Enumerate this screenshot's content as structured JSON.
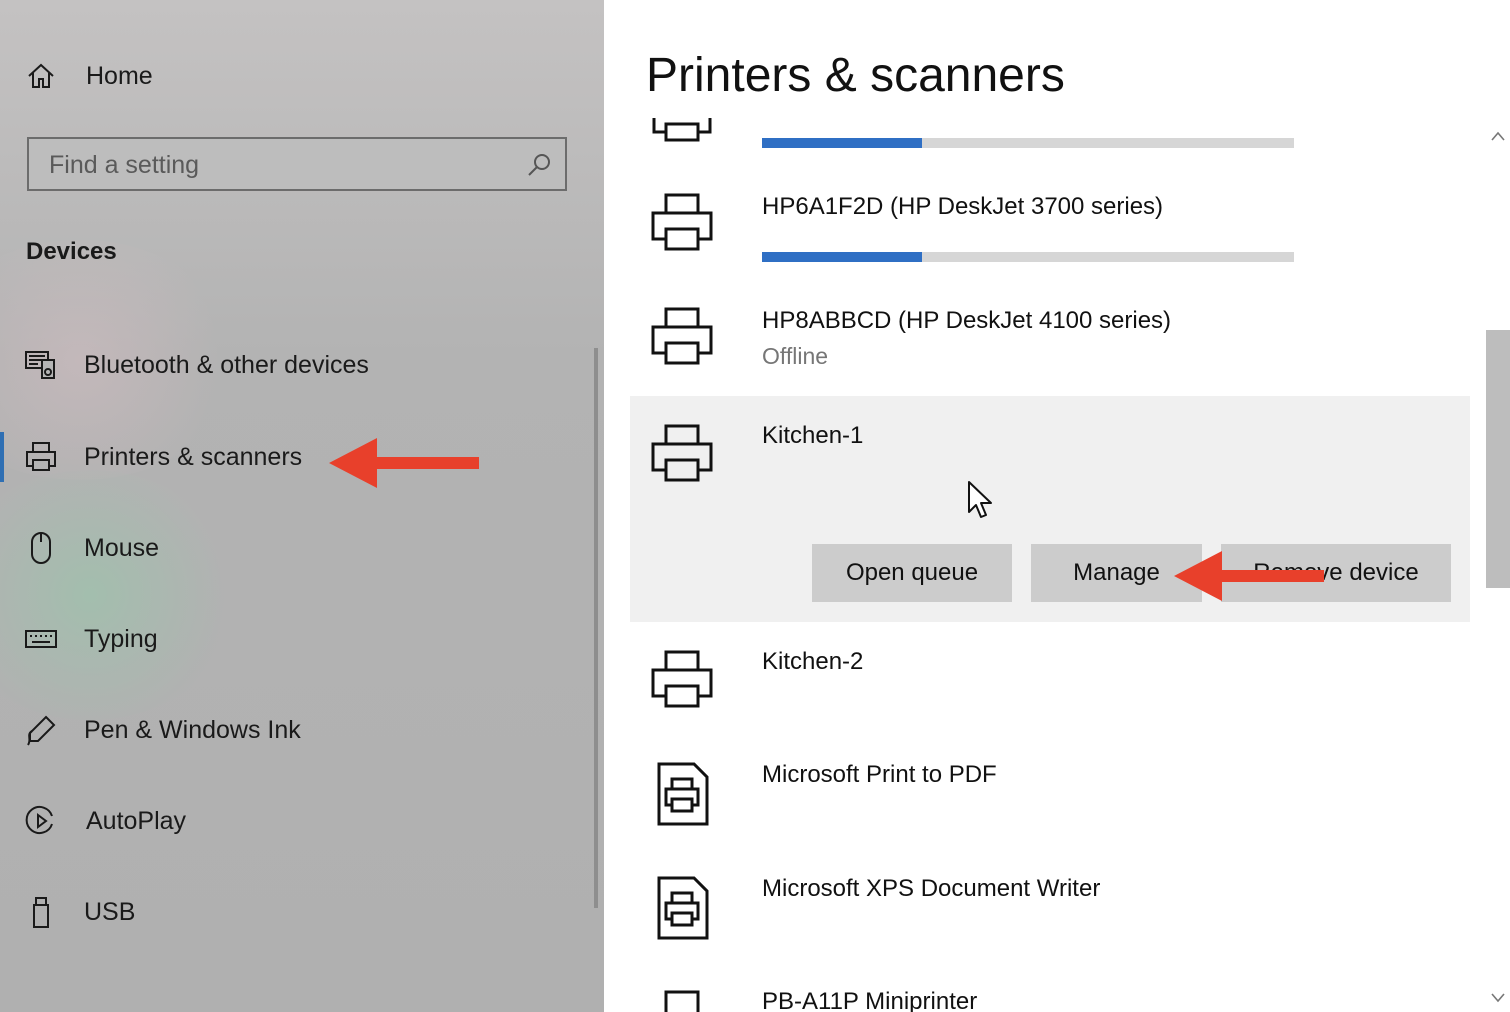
{
  "sidebar": {
    "home_label": "Home",
    "search_placeholder": "Find a setting",
    "section_title": "Devices",
    "items": [
      {
        "label": "Bluetooth & other devices",
        "icon": "bluetooth-devices-icon"
      },
      {
        "label": "Printers & scanners",
        "icon": "printer-icon",
        "selected": true
      },
      {
        "label": "Mouse",
        "icon": "mouse-icon"
      },
      {
        "label": "Typing",
        "icon": "keyboard-icon"
      },
      {
        "label": "Pen & Windows Ink",
        "icon": "pen-icon"
      },
      {
        "label": "AutoPlay",
        "icon": "autoplay-icon"
      },
      {
        "label": "USB",
        "icon": "usb-icon"
      }
    ]
  },
  "main": {
    "title": "Printers & scanners",
    "printers": [
      {
        "name": "",
        "progress": 0.3
      },
      {
        "name": "HP6A1F2D (HP DeskJet 3700 series)",
        "progress": 0.3
      },
      {
        "name": "HP8ABBCD (HP DeskJet 4100 series)",
        "status": "Offline"
      },
      {
        "name": "Kitchen-1",
        "selected": true
      },
      {
        "name": "Kitchen-2"
      },
      {
        "name": "Microsoft Print to PDF"
      },
      {
        "name": "Microsoft XPS Document Writer"
      },
      {
        "name": "PB-A11P Miniprinter"
      }
    ],
    "actions": {
      "open_queue": "Open queue",
      "manage": "Manage",
      "remove_device": "Remove device"
    }
  },
  "colors": {
    "accent": "#2f6fb3",
    "progress_fill": "#2f6fc4",
    "annotation_arrow": "#e8402b"
  }
}
